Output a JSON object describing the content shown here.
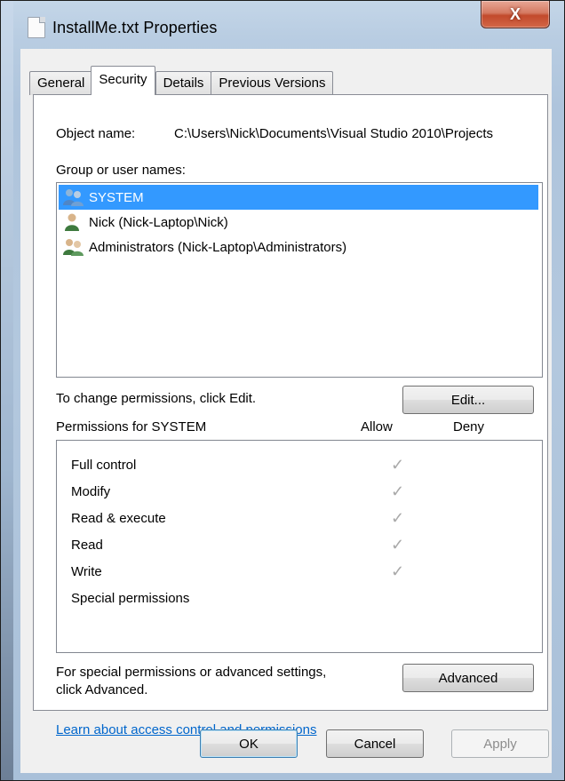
{
  "window": {
    "title": "InstallMe.txt Properties",
    "close_glyph": "X"
  },
  "tabs": [
    {
      "label": "General",
      "active": false
    },
    {
      "label": "Security",
      "active": true
    },
    {
      "label": "Details",
      "active": false
    },
    {
      "label": "Previous Versions",
      "active": false
    }
  ],
  "security": {
    "object_name_label": "Object name:",
    "object_name_value": "C:\\Users\\Nick\\Documents\\Visual Studio 2010\\Projects",
    "group_label": "Group or user names:",
    "users": [
      {
        "name": "SYSTEM",
        "icon": "user-group-icon",
        "selected": true
      },
      {
        "name": "Nick (Nick-Laptop\\Nick)",
        "icon": "user-icon",
        "selected": false
      },
      {
        "name": "Administrators (Nick-Laptop\\Administrators)",
        "icon": "user-group-icon",
        "selected": false
      }
    ],
    "change_text": "To change permissions, click Edit.",
    "edit_button": "Edit...",
    "permissions_header": "Permissions for SYSTEM",
    "allow_header": "Allow",
    "deny_header": "Deny",
    "permissions": [
      {
        "name": "Full control",
        "allow": true,
        "deny": false
      },
      {
        "name": "Modify",
        "allow": true,
        "deny": false
      },
      {
        "name": "Read & execute",
        "allow": true,
        "deny": false
      },
      {
        "name": "Read",
        "allow": true,
        "deny": false
      },
      {
        "name": "Write",
        "allow": true,
        "deny": false
      },
      {
        "name": "Special permissions",
        "allow": false,
        "deny": false
      }
    ],
    "special_text_line1": "For special permissions or advanced settings,",
    "special_text_line2": "click Advanced.",
    "advanced_button": "Advanced",
    "learn_link": "Learn about access control and permissions"
  },
  "footer": {
    "ok": "OK",
    "cancel": "Cancel",
    "apply": "Apply"
  },
  "colors": {
    "selection": "#3399ff",
    "link": "#0066cc",
    "check": "#a9a9a9"
  }
}
